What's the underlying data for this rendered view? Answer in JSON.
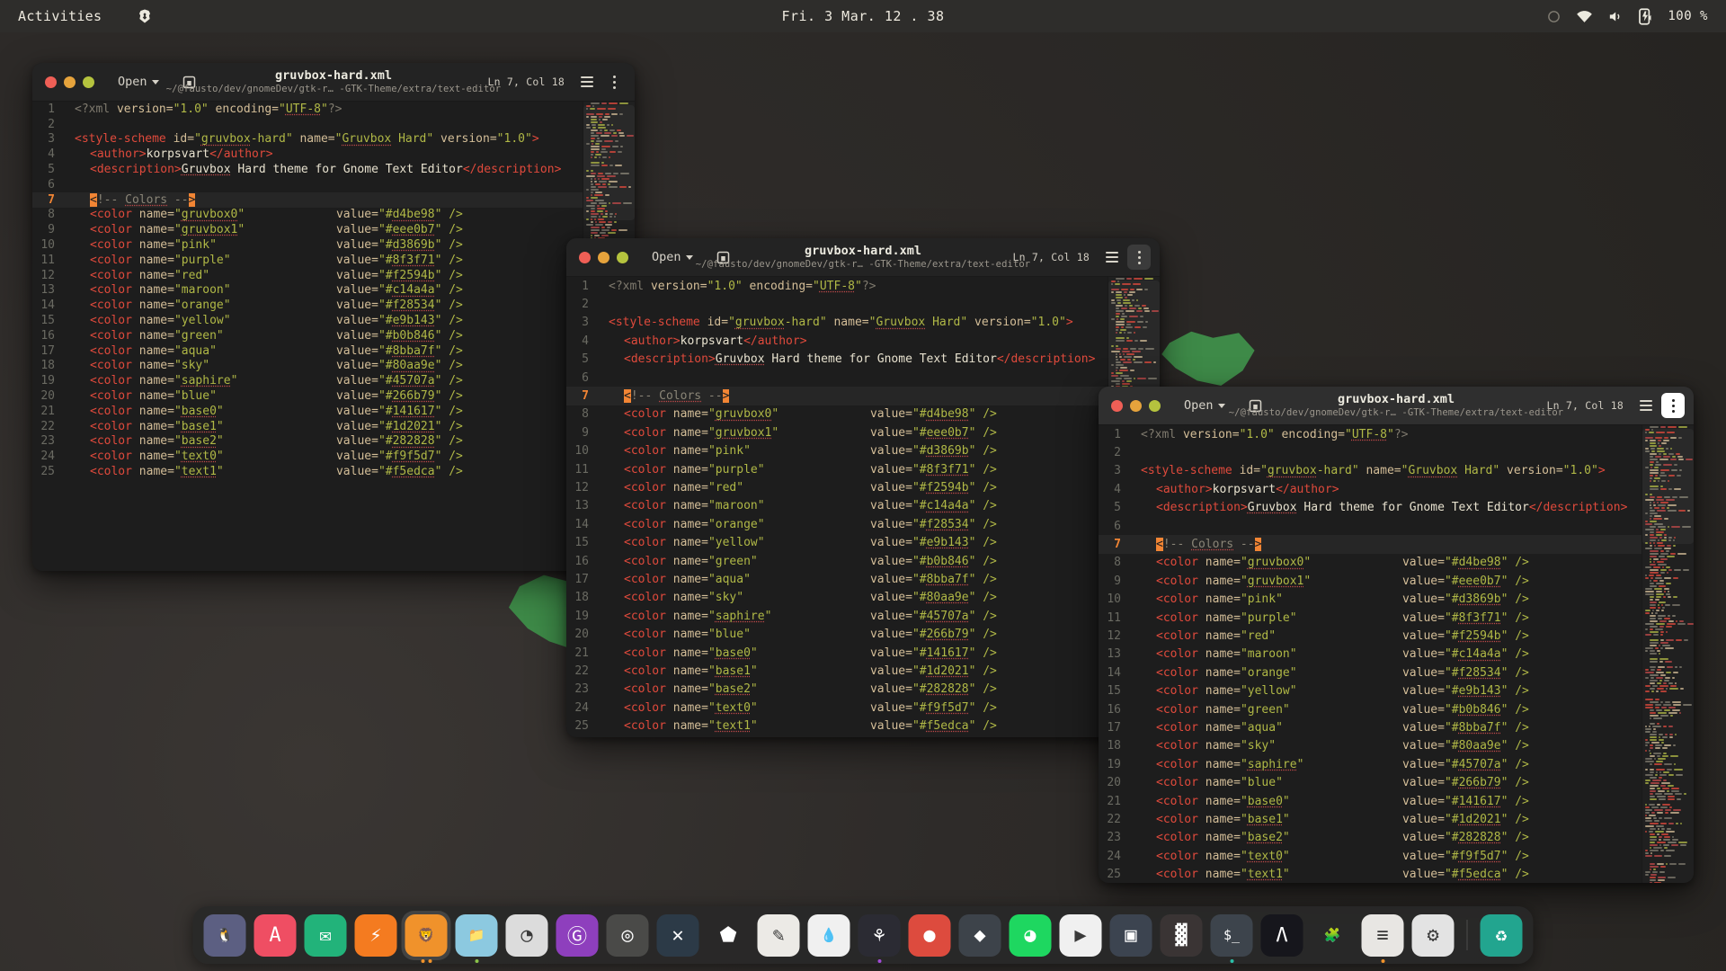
{
  "topbar": {
    "activities": "Activities",
    "app_icon": "brave-icon",
    "clock": "Fri. 3 Mar.  12 . 38",
    "battery_percent": "100 %",
    "tray_icons": [
      "night-light-icon",
      "wifi-icon",
      "volume-icon",
      "battery-charging-icon"
    ]
  },
  "window_common": {
    "open_label": "Open",
    "title": "gruvbox-hard.xml",
    "path": "~/@fausto/dev/gnomeDev/gtk-r… -GTK-Theme/extra/text-editor",
    "position": "Ln 7, Col 18",
    "save_icon": "save-icon",
    "menu_icon": "hamburger-menu-icon",
    "options_icon": "kebab-menu-icon"
  },
  "editor": {
    "lines": [
      {
        "n": "1",
        "tokens": [
          {
            "t": "<?xml ",
            "c": "punct"
          },
          {
            "t": "version=",
            "c": "attr"
          },
          {
            "t": "\"1.0\"",
            "c": "str"
          },
          {
            "t": " encoding=",
            "c": "attr"
          },
          {
            "t": "\"",
            "c": "str"
          },
          {
            "t": "UTF-8",
            "c": "str sq"
          },
          {
            "t": "\"",
            "c": "str"
          },
          {
            "t": "?>",
            "c": "punct"
          }
        ]
      },
      {
        "n": "2",
        "tokens": []
      },
      {
        "n": "3",
        "tokens": [
          {
            "t": "<style-scheme ",
            "c": "tag"
          },
          {
            "t": "id=",
            "c": "attr"
          },
          {
            "t": "\"",
            "c": "str"
          },
          {
            "t": "gruvbox",
            "c": "str sq"
          },
          {
            "t": "-hard\"",
            "c": "str"
          },
          {
            "t": " name=",
            "c": "attr"
          },
          {
            "t": "\"",
            "c": "str"
          },
          {
            "t": "Gruvbox",
            "c": "str sq"
          },
          {
            "t": " Hard\"",
            "c": "str"
          },
          {
            "t": " version=",
            "c": "attr"
          },
          {
            "t": "\"1.0\"",
            "c": "str"
          },
          {
            "t": ">",
            "c": "tag"
          }
        ]
      },
      {
        "n": "4",
        "indent": 1,
        "tokens": [
          {
            "t": "<author>",
            "c": "tag"
          },
          {
            "t": "korpsvart",
            "c": "txt"
          },
          {
            "t": "</author>",
            "c": "tag"
          }
        ]
      },
      {
        "n": "5",
        "indent": 1,
        "tokens": [
          {
            "t": "<description>",
            "c": "tag"
          },
          {
            "t": "Gruvbox",
            "c": "txt sq"
          },
          {
            "t": " Hard theme for Gnome Text Editor",
            "c": "txt"
          },
          {
            "t": "</description>",
            "c": "tag"
          }
        ]
      },
      {
        "n": "6",
        "tokens": []
      },
      {
        "n": "7",
        "current": true,
        "indent": 1,
        "tokens": [
          {
            "t": "<",
            "c": "match"
          },
          {
            "t": "!-- ",
            "c": "cmt"
          },
          {
            "t": "Colors",
            "c": "cmt sq"
          },
          {
            "t": " --",
            "c": "cmt"
          },
          {
            "t": ">",
            "c": "match"
          }
        ]
      },
      {
        "n": "8",
        "indent": 1,
        "tokens": [
          {
            "t": "<color ",
            "c": "tag"
          },
          {
            "t": "name=",
            "c": "attr"
          },
          {
            "t": "\"",
            "c": "str"
          },
          {
            "t": "gruvbox0",
            "c": "str sq"
          },
          {
            "t": "\"",
            "c": "str"
          }
        ],
        "value": {
          "attr": "value=",
          "q1": "\"#",
          "hex": "d4be98",
          "q2": "\" />"
        }
      },
      {
        "n": "9",
        "indent": 1,
        "tokens": [
          {
            "t": "<color ",
            "c": "tag"
          },
          {
            "t": "name=",
            "c": "attr"
          },
          {
            "t": "\"",
            "c": "str"
          },
          {
            "t": "gruvbox1",
            "c": "str sq"
          },
          {
            "t": "\"",
            "c": "str"
          }
        ],
        "value": {
          "attr": "value=",
          "q1": "\"#",
          "hex": "eee0b7",
          "q2": "\" />"
        }
      },
      {
        "n": "10",
        "indent": 1,
        "tokens": [
          {
            "t": "<color ",
            "c": "tag"
          },
          {
            "t": "name=",
            "c": "attr"
          },
          {
            "t": "\"pink\"",
            "c": "str"
          }
        ],
        "value": {
          "attr": "value=",
          "q1": "\"#",
          "hex": "d3869b",
          "q2": "\" />"
        }
      },
      {
        "n": "11",
        "indent": 1,
        "tokens": [
          {
            "t": "<color ",
            "c": "tag"
          },
          {
            "t": "name=",
            "c": "attr"
          },
          {
            "t": "\"purple\"",
            "c": "str"
          }
        ],
        "value": {
          "attr": "value=",
          "q1": "\"#",
          "hex": "8f3f71",
          "q2": "\" />"
        }
      },
      {
        "n": "12",
        "indent": 1,
        "tokens": [
          {
            "t": "<color ",
            "c": "tag"
          },
          {
            "t": "name=",
            "c": "attr"
          },
          {
            "t": "\"red\"",
            "c": "str"
          }
        ],
        "value": {
          "attr": "value=",
          "q1": "\"#",
          "hex": "f2594b",
          "q2": "\" />"
        }
      },
      {
        "n": "13",
        "indent": 1,
        "tokens": [
          {
            "t": "<color ",
            "c": "tag"
          },
          {
            "t": "name=",
            "c": "attr"
          },
          {
            "t": "\"maroon\"",
            "c": "str"
          }
        ],
        "value": {
          "attr": "value=",
          "q1": "\"#",
          "hex": "c14a4a",
          "q2": "\" />"
        }
      },
      {
        "n": "14",
        "indent": 1,
        "tokens": [
          {
            "t": "<color ",
            "c": "tag"
          },
          {
            "t": "name=",
            "c": "attr"
          },
          {
            "t": "\"orange\"",
            "c": "str"
          }
        ],
        "value": {
          "attr": "value=",
          "q1": "\"#",
          "hex": "f28534",
          "q2": "\" />"
        }
      },
      {
        "n": "15",
        "indent": 1,
        "tokens": [
          {
            "t": "<color ",
            "c": "tag"
          },
          {
            "t": "name=",
            "c": "attr"
          },
          {
            "t": "\"yellow\"",
            "c": "str"
          }
        ],
        "value": {
          "attr": "value=",
          "q1": "\"#",
          "hex": "e9b143",
          "q2": "\" />"
        }
      },
      {
        "n": "16",
        "indent": 1,
        "tokens": [
          {
            "t": "<color ",
            "c": "tag"
          },
          {
            "t": "name=",
            "c": "attr"
          },
          {
            "t": "\"green\"",
            "c": "str"
          }
        ],
        "value": {
          "attr": "value=",
          "q1": "\"#",
          "hex": "b0b846",
          "q2": "\" />"
        }
      },
      {
        "n": "17",
        "indent": 1,
        "tokens": [
          {
            "t": "<color ",
            "c": "tag"
          },
          {
            "t": "name=",
            "c": "attr"
          },
          {
            "t": "\"aqua\"",
            "c": "str"
          }
        ],
        "value": {
          "attr": "value=",
          "q1": "\"#",
          "hex": "8bba7f",
          "q2": "\" />"
        }
      },
      {
        "n": "18",
        "indent": 1,
        "tokens": [
          {
            "t": "<color ",
            "c": "tag"
          },
          {
            "t": "name=",
            "c": "attr"
          },
          {
            "t": "\"sky\"",
            "c": "str"
          }
        ],
        "value": {
          "attr": "value=",
          "q1": "\"#",
          "hex": "80aa9e",
          "q2": "\" />"
        }
      },
      {
        "n": "19",
        "indent": 1,
        "tokens": [
          {
            "t": "<color ",
            "c": "tag"
          },
          {
            "t": "name=",
            "c": "attr"
          },
          {
            "t": "\"",
            "c": "str"
          },
          {
            "t": "saphire",
            "c": "str sq"
          },
          {
            "t": "\"",
            "c": "str"
          }
        ],
        "value": {
          "attr": "value=",
          "q1": "\"#",
          "hex": "45707a",
          "q2": "\" />"
        }
      },
      {
        "n": "20",
        "indent": 1,
        "tokens": [
          {
            "t": "<color ",
            "c": "tag"
          },
          {
            "t": "name=",
            "c": "attr"
          },
          {
            "t": "\"blue\"",
            "c": "str"
          }
        ],
        "value": {
          "attr": "value=",
          "q1": "\"#",
          "hex": "266b79",
          "q2": "\" />"
        }
      },
      {
        "n": "21",
        "indent": 1,
        "tokens": [
          {
            "t": "<color ",
            "c": "tag"
          },
          {
            "t": "name=",
            "c": "attr"
          },
          {
            "t": "\"",
            "c": "str"
          },
          {
            "t": "base0",
            "c": "str sq"
          },
          {
            "t": "\"",
            "c": "str"
          }
        ],
        "value": {
          "attr": "value=",
          "q1": "\"#",
          "hex": "141617",
          "q2": "\" />"
        }
      },
      {
        "n": "22",
        "indent": 1,
        "tokens": [
          {
            "t": "<color ",
            "c": "tag"
          },
          {
            "t": "name=",
            "c": "attr"
          },
          {
            "t": "\"",
            "c": "str"
          },
          {
            "t": "base1",
            "c": "str sq"
          },
          {
            "t": "\"",
            "c": "str"
          }
        ],
        "value": {
          "attr": "value=",
          "q1": "\"#",
          "hex": "1d2021",
          "q2": "\" />"
        }
      },
      {
        "n": "23",
        "indent": 1,
        "tokens": [
          {
            "t": "<color ",
            "c": "tag"
          },
          {
            "t": "name=",
            "c": "attr"
          },
          {
            "t": "\"",
            "c": "str"
          },
          {
            "t": "base2",
            "c": "str sq"
          },
          {
            "t": "\"",
            "c": "str"
          }
        ],
        "value": {
          "attr": "value=",
          "q1": "\"#",
          "hex": "282828",
          "q2": "\" />"
        }
      },
      {
        "n": "24",
        "indent": 1,
        "tokens": [
          {
            "t": "<color ",
            "c": "tag"
          },
          {
            "t": "name=",
            "c": "attr"
          },
          {
            "t": "\"",
            "c": "str"
          },
          {
            "t": "text0",
            "c": "str sq"
          },
          {
            "t": "\"",
            "c": "str"
          }
        ],
        "value": {
          "attr": "value=",
          "q1": "\"#",
          "hex": "f9f5d7",
          "q2": "\" />"
        }
      },
      {
        "n": "25",
        "indent": 1,
        "tokens": [
          {
            "t": "<color ",
            "c": "tag"
          },
          {
            "t": "name=",
            "c": "attr"
          },
          {
            "t": "\"",
            "c": "str"
          },
          {
            "t": "text1",
            "c": "str sq"
          },
          {
            "t": "\"",
            "c": "str"
          }
        ],
        "value": {
          "attr": "value=",
          "q1": "\"#",
          "hex": "f5edca",
          "q2": "\" />"
        }
      }
    ]
  },
  "palette": {
    "tag": "#e04a3c",
    "attr": "#d4be98",
    "string": "#b0b846",
    "comment": "#8a8577",
    "match_highlight": "#f28534",
    "editor_bg": "#1d1d1d",
    "titlebar_bg": "#232323",
    "titlebar_active_bg": "#2f2f2f"
  },
  "dock": {
    "items": [
      {
        "name": "firefox-icon",
        "label": "Firefox",
        "bg": "#5c5f82",
        "glyph": "🐧",
        "running": []
      },
      {
        "name": "affinity-icon",
        "label": "Affinity",
        "bg": "#ef4e63",
        "glyph": "A",
        "running": []
      },
      {
        "name": "mail-icon",
        "label": "Mail",
        "bg": "#22b37a",
        "glyph": "✉",
        "running": []
      },
      {
        "name": "thunder-icon",
        "label": "Thunder",
        "bg": "#f47b20",
        "glyph": "⚡",
        "running": []
      },
      {
        "name": "brave-icon",
        "label": "Brave",
        "bg": "#f0922b",
        "glyph": "🦁",
        "running": [
          "#f0922b",
          "#f0922b"
        ],
        "focused": true
      },
      {
        "name": "files-icon",
        "label": "Files",
        "bg": "#8cc9e0",
        "glyph": "📁",
        "running": [
          "#8bc34a"
        ]
      },
      {
        "name": "disks-icon",
        "label": "Disks",
        "bg": "#dcdcdc",
        "glyph": "◔",
        "running": []
      },
      {
        "name": "github-icon",
        "label": "GitHub",
        "bg": "#8e3fbd",
        "glyph": "Ⓖ",
        "running": []
      },
      {
        "name": "insomnia-icon",
        "label": "Insomnia",
        "bg": "#4a4a48",
        "glyph": "◎",
        "running": []
      },
      {
        "name": "vscode-icon",
        "label": "VS Code",
        "bg": "#2c3a47",
        "glyph": "✕",
        "running": []
      },
      {
        "name": "obsidian-icon",
        "label": "Obsidian",
        "bg": "transparent",
        "glyph": "⬟",
        "running": []
      },
      {
        "name": "text-editor-icon",
        "label": "Text Editor",
        "bg": "#eceae6",
        "glyph": "✎",
        "running": []
      },
      {
        "name": "color-picker-icon",
        "label": "Color Picker",
        "bg": "#f0f0f0",
        "glyph": "💧",
        "running": []
      },
      {
        "name": "figma-icon",
        "label": "Figma",
        "bg": "#2b2b33",
        "glyph": "⚘",
        "running": [
          "#a24bd6"
        ]
      },
      {
        "name": "photos-icon",
        "label": "Photos",
        "bg": "#dd4b3e",
        "glyph": "●",
        "running": []
      },
      {
        "name": "inkscape-icon",
        "label": "Inkscape",
        "bg": "#3d434a",
        "glyph": "◆",
        "running": []
      },
      {
        "name": "spotify-icon",
        "label": "Spotify",
        "bg": "#1ed760",
        "glyph": "◕",
        "running": []
      },
      {
        "name": "mediaplayer-icon",
        "label": "Media Player",
        "bg": "#f0f0f0",
        "glyph": "▶",
        "running": []
      },
      {
        "name": "boxes-icon",
        "label": "Boxes",
        "bg": "#3c4450",
        "glyph": "▣",
        "running": []
      },
      {
        "name": "system-monitor-icon",
        "label": "System Monitor",
        "bg": "#3a3434",
        "glyph": "▓",
        "running": []
      },
      {
        "name": "terminal-icon",
        "label": "Terminal",
        "bg": "#3d444c",
        "glyph": "$_",
        "running": [
          "#2bbfa8"
        ]
      },
      {
        "name": "alacritty-icon",
        "label": "Alacritty",
        "bg": "#16161c",
        "glyph": "Λ",
        "running": []
      },
      {
        "name": "extensions-icon",
        "label": "Extensions",
        "bg": "transparent",
        "glyph": "🧩",
        "running": []
      },
      {
        "name": "tweaks-icon",
        "label": "Tweaks",
        "bg": "#e8e6e3",
        "glyph": "≡",
        "running": [
          "#f0922b"
        ]
      },
      {
        "name": "settings-icon",
        "label": "Settings",
        "bg": "#e3e3e3",
        "glyph": "⚙",
        "running": []
      },
      {
        "name": "separator",
        "label": "",
        "bg": "transparent",
        "glyph": "",
        "running": []
      },
      {
        "name": "trash-icon",
        "label": "Trash",
        "bg": "#22a58f",
        "glyph": "♻",
        "running": []
      }
    ]
  }
}
